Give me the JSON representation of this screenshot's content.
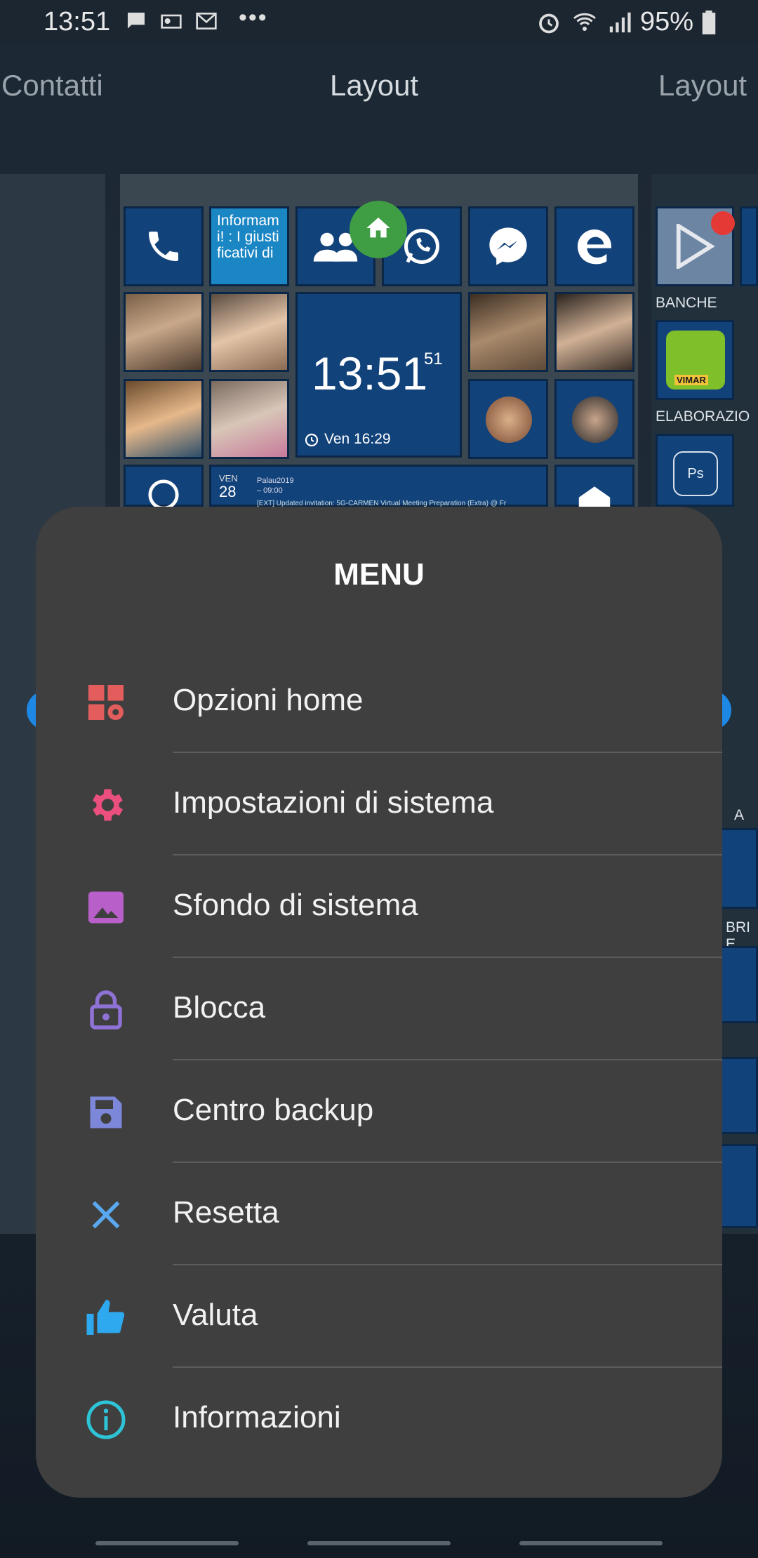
{
  "status_bar": {
    "time": "13:51",
    "battery": "95%",
    "more": "•••"
  },
  "layout_tabs": {
    "left": "Contatti",
    "center": "Layout",
    "right": "Layout"
  },
  "preview": {
    "info_tile_text": "Informam i! : I giusti ficativi di",
    "clock_time": "13:51",
    "clock_seconds": "51",
    "alarm_text": "Ven 16:29",
    "calendar_day": "VEN",
    "calendar_date": "28",
    "calendar_event_1": "Palau2019",
    "calendar_event_1_time": "– 09:00",
    "calendar_event_2": "[EXT] Updated invitation: 5G-CARMEN Virtual Meeting Preparation (Extra) @ Fr",
    "next_group_1": "BANCHE",
    "next_group_2": "ELABORAZIO",
    "next_group_3": "A",
    "next_group_4": "BRI E",
    "vimar_label": "VIMAR",
    "ps_label": "Ps"
  },
  "menu": {
    "title": "MENU",
    "items": [
      {
        "label": "Opzioni home",
        "icon": "home-options-icon",
        "color": "#e35d5d"
      },
      {
        "label": "Impostazioni di sistema",
        "icon": "gear-icon",
        "color": "#ea4f7d"
      },
      {
        "label": "Sfondo di sistema",
        "icon": "image-icon",
        "color": "#b95fc9"
      },
      {
        "label": "Blocca",
        "icon": "lock-icon",
        "color": "#8f72d6"
      },
      {
        "label": "Centro backup",
        "icon": "save-icon",
        "color": "#7d87d9"
      },
      {
        "label": "Resetta",
        "icon": "close-icon",
        "color": "#5aa8ef"
      },
      {
        "label": "Valuta",
        "icon": "thumbs-up-icon",
        "color": "#2ea8ee"
      },
      {
        "label": "Informazioni",
        "icon": "info-icon",
        "color": "#2ec4d8"
      }
    ]
  }
}
